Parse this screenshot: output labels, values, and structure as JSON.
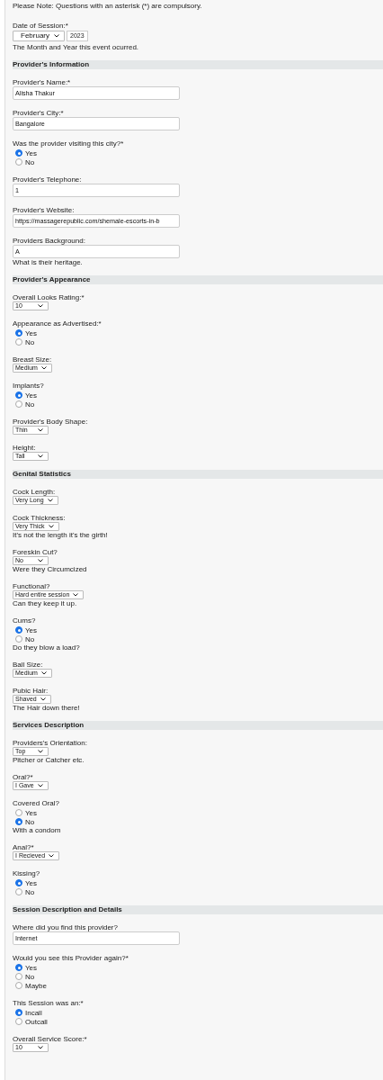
{
  "note": "Please Note: Questions with an asterisk (*) are compulsory.",
  "items": [
    {
      "kind": "date",
      "label": "Date of Session:*",
      "month": "February",
      "year": "2023",
      "help": "The Month and Year this event ocurred."
    },
    {
      "kind": "section",
      "title": "Provider's Information"
    },
    {
      "kind": "text",
      "label": "Provider's Name:*",
      "value": "Alisha Thakur"
    },
    {
      "kind": "text",
      "label": "Provider's City:*",
      "value": "Bangalore"
    },
    {
      "kind": "radio",
      "label": "Was the provider visiting this city?*",
      "options": [
        {
          "label": "Yes",
          "selected": true
        },
        {
          "label": "No",
          "selected": false
        }
      ]
    },
    {
      "kind": "text",
      "label": "Provider's Telephone:",
      "value": "1"
    },
    {
      "kind": "text",
      "label": "Provider's Website:",
      "value": "https://massagerepublic.com/shemale-escorts-in-b"
    },
    {
      "kind": "text",
      "label": "Providers Background:",
      "value": "A",
      "help": "What is their heritage."
    },
    {
      "kind": "section",
      "title": "Provider's Appearance"
    },
    {
      "kind": "select",
      "label": "Overall Looks Rating:*",
      "value": "10"
    },
    {
      "kind": "radio",
      "label": "Appearance as Advertised:*",
      "options": [
        {
          "label": "Yes",
          "selected": true
        },
        {
          "label": "No",
          "selected": false
        }
      ]
    },
    {
      "kind": "select",
      "label": "Breast Size:",
      "value": "Medium"
    },
    {
      "kind": "radio",
      "label": "Implants?",
      "options": [
        {
          "label": "Yes",
          "selected": true
        },
        {
          "label": "No",
          "selected": false
        }
      ]
    },
    {
      "kind": "select",
      "label": "Provider's Body Shape:",
      "value": "Thin"
    },
    {
      "kind": "select",
      "label": "Height:",
      "value": "Tall"
    },
    {
      "kind": "section",
      "title": "Genital Statistics"
    },
    {
      "kind": "select",
      "label": "Cock Length:",
      "value": "Very Long"
    },
    {
      "kind": "select",
      "label": "Cock Thickness:",
      "value": "Very Thick",
      "help": "It's not the length it's the girth!"
    },
    {
      "kind": "select",
      "label": "Foreskin Cut?",
      "value": "No",
      "help": "Were they Circumcized"
    },
    {
      "kind": "select",
      "label": "Functional?",
      "value": "Hard entire session",
      "help": "Can they keep it up."
    },
    {
      "kind": "radio",
      "label": "Cums?",
      "options": [
        {
          "label": "Yes",
          "selected": true
        },
        {
          "label": "No",
          "selected": false
        }
      ],
      "help": "Do they blow a load?"
    },
    {
      "kind": "select",
      "label": "Ball Size:",
      "value": "Medium"
    },
    {
      "kind": "select",
      "label": "Pubic Hair:",
      "value": "Shaved",
      "help": "The Hair down there!"
    },
    {
      "kind": "section",
      "title": "Services Description"
    },
    {
      "kind": "select",
      "label": "Providers's Orientation:",
      "value": "Top",
      "help": "Pitcher or Catcher etc."
    },
    {
      "kind": "select",
      "label": "Oral?*",
      "value": "I Gave"
    },
    {
      "kind": "radio",
      "label": "Covered Oral?",
      "options": [
        {
          "label": "Yes",
          "selected": false
        },
        {
          "label": "No",
          "selected": true
        }
      ],
      "help": "With a condom"
    },
    {
      "kind": "select",
      "label": "Anal?*",
      "value": "I Recieved"
    },
    {
      "kind": "radio",
      "label": "Kissing?",
      "options": [
        {
          "label": "Yes",
          "selected": true
        },
        {
          "label": "No",
          "selected": false
        }
      ]
    },
    {
      "kind": "section",
      "title": "Session Description and Details"
    },
    {
      "kind": "text",
      "label": "Where did you find this provider?",
      "value": "Internet"
    },
    {
      "kind": "radio",
      "label": "Would you see this Provider again?*",
      "options": [
        {
          "label": "Yes",
          "selected": true
        },
        {
          "label": "No",
          "selected": false
        },
        {
          "label": "Maybe",
          "selected": false
        }
      ]
    },
    {
      "kind": "radio",
      "label": "This Session was an:*",
      "options": [
        {
          "label": "Incall",
          "selected": true
        },
        {
          "label": "Outcall",
          "selected": false
        }
      ]
    },
    {
      "kind": "select",
      "label": "Overall Service Score:*",
      "value": "10"
    }
  ]
}
